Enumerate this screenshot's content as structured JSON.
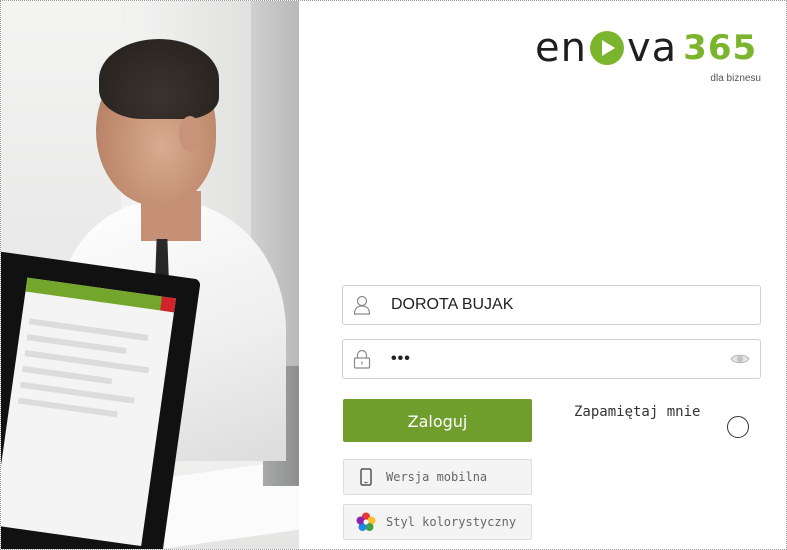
{
  "logo": {
    "wordmark_left": "en",
    "wordmark_right": "va",
    "number": "365",
    "tagline": "dla biznesu"
  },
  "login_form": {
    "username_value": "DOROTA BUJAK",
    "password_value": "•••",
    "submit_label": "Zaloguj",
    "remember_label": "Zapamiętaj mnie",
    "remember_checked": false
  },
  "secondary_buttons": {
    "mobile_label": "Wersja mobilna",
    "style_label": "Styl kolorystyczny"
  },
  "icons": {
    "username": "user-icon",
    "password": "lock-icon",
    "show_password": "eye-icon",
    "mobile": "phone-icon",
    "style": "flower-color-icon"
  },
  "colors": {
    "brand_green": "#7bb52d",
    "button_green": "#6f9e2c",
    "text_dark": "#1f1f1f"
  }
}
